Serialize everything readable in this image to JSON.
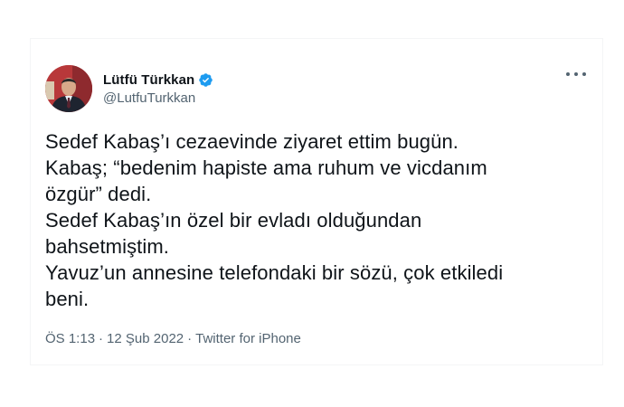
{
  "author": {
    "display_name": "Lütfü Türkkan",
    "handle": "@LutfuTurkkan",
    "verified": true,
    "verified_color": "#1d9bf0",
    "avatar_icon": "user-avatar-photo"
  },
  "more_icon": "more-horizontal-icon",
  "tweet": {
    "lines": [
      "Sedef Kabaş’ı cezaevinde ziyaret ettim bugün.",
      "Kabaş; “bedenim hapiste ama ruhum ve vicdanım",
      "özgür” dedi.",
      "Sedef Kabaş’ın özel bir evladı olduğundan",
      "bahsetmiştim.",
      "Yavuz’un annesine telefondaki bir sözü, çok etkiledi",
      "beni."
    ]
  },
  "meta": {
    "time": "ÖS 1:13",
    "separator": "·",
    "date": "12 Şub 2022",
    "source": "Twitter for iPhone"
  }
}
